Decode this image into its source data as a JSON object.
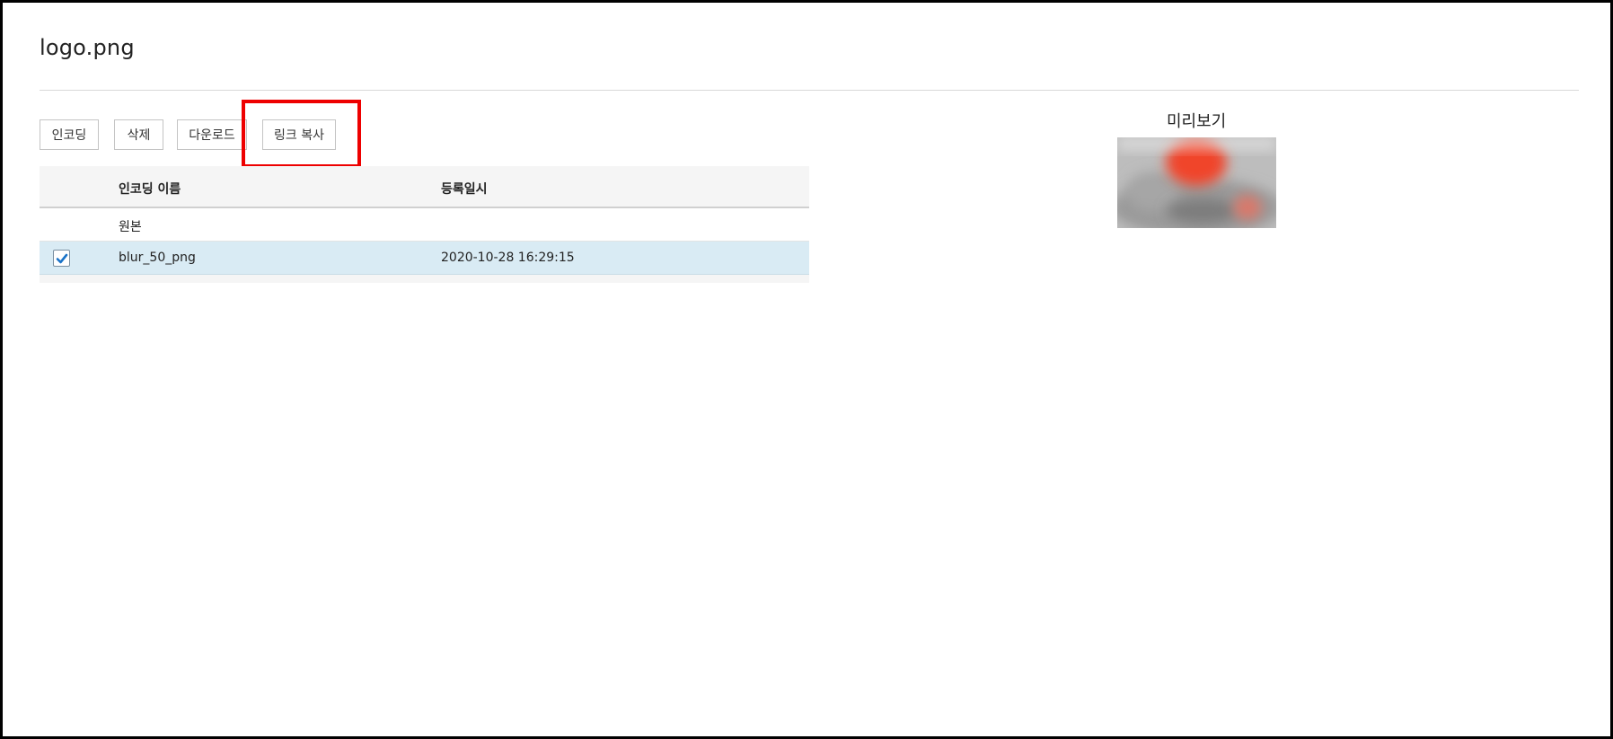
{
  "file": {
    "title": "logo.png"
  },
  "toolbar": {
    "encode_label": "인코딩",
    "delete_label": "삭제",
    "download_label": "다운로드",
    "copy_link_label": "링크 복사"
  },
  "table": {
    "headers": {
      "name": "인코딩 이름",
      "date": "등록일시"
    },
    "rows": [
      {
        "name": "원본",
        "date": "",
        "checked": false,
        "selectable": false
      },
      {
        "name": "blur_50_png",
        "date": "2020-10-28 16:29:15",
        "checked": true,
        "selectable": true
      }
    ]
  },
  "preview": {
    "label": "미리보기"
  },
  "colors": {
    "highlight": "#ee0000",
    "selected_row": "#d9ebf4",
    "checkbox_check": "#1a73c8"
  }
}
